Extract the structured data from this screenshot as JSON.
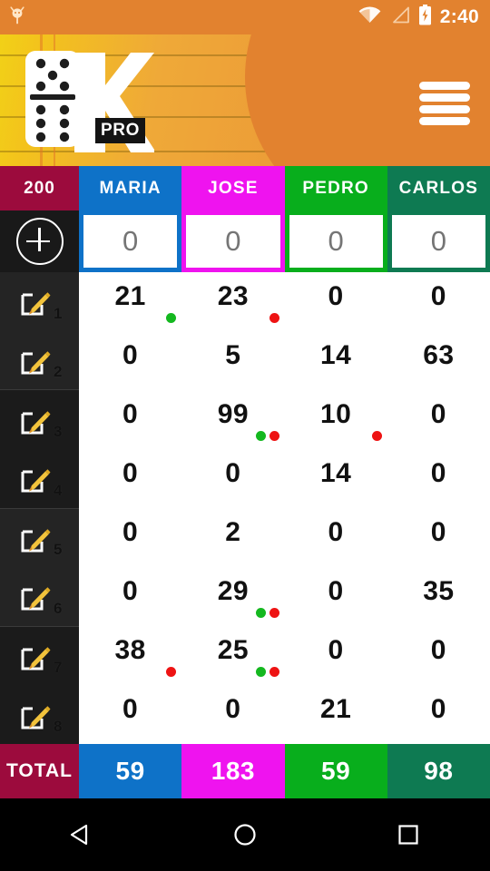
{
  "status_bar": {
    "notification_icon": "android-robot-icon",
    "wifi_icon": "wifi-icon",
    "signal_icon": "signal-triangle-icon",
    "battery_icon": "battery-charging-icon",
    "time": "2:40"
  },
  "header": {
    "logo_name": "domino-k-pro-logo",
    "logo_badge": "PRO",
    "menu_icon": "hamburger-menu-icon"
  },
  "colors": {
    "goal": "#9c0b3d",
    "maria": "#0e72c8",
    "jose": "#ef13ef",
    "pedro": "#08ae1c",
    "carlos": "#0e7a52",
    "accent_orange": "#e2822f",
    "dot_green": "#14b81f",
    "dot_red": "#ee1313"
  },
  "goal": {
    "label": "200"
  },
  "add_round_button": {
    "icon": "plus-circle-icon"
  },
  "players": [
    {
      "name": "MARIA",
      "color": "#0e72c8",
      "input_value": "",
      "input_placeholder": "0"
    },
    {
      "name": "JOSE",
      "color": "#ef13ef",
      "input_value": "",
      "input_placeholder": "0"
    },
    {
      "name": "PEDRO",
      "color": "#08ae1c",
      "input_value": "",
      "input_placeholder": "0"
    },
    {
      "name": "CARLOS",
      "color": "#0e7a52",
      "input_value": "",
      "input_placeholder": "0"
    }
  ],
  "rounds": [
    {
      "num": "1",
      "edit_icon": "pencil-edit-icon",
      "scores": [
        "21",
        "23",
        "0",
        "0"
      ],
      "marks": [
        [
          "green"
        ],
        [
          "red"
        ],
        [],
        []
      ]
    },
    {
      "num": "2",
      "edit_icon": "pencil-edit-icon",
      "scores": [
        "0",
        "5",
        "14",
        "63"
      ],
      "marks": [
        [],
        [],
        [],
        []
      ]
    },
    {
      "num": "3",
      "edit_icon": "pencil-edit-icon",
      "scores": [
        "0",
        "99",
        "10",
        "0"
      ],
      "marks": [
        [],
        [
          "green",
          "red"
        ],
        [
          "red"
        ],
        []
      ]
    },
    {
      "num": "4",
      "edit_icon": "pencil-edit-icon",
      "scores": [
        "0",
        "0",
        "14",
        "0"
      ],
      "marks": [
        [],
        [],
        [],
        []
      ]
    },
    {
      "num": "5",
      "edit_icon": "pencil-edit-icon",
      "scores": [
        "0",
        "2",
        "0",
        "0"
      ],
      "marks": [
        [],
        [],
        [],
        []
      ]
    },
    {
      "num": "6",
      "edit_icon": "pencil-edit-icon",
      "scores": [
        "0",
        "29",
        "0",
        "35"
      ],
      "marks": [
        [],
        [
          "green",
          "red"
        ],
        [],
        []
      ]
    },
    {
      "num": "7",
      "edit_icon": "pencil-edit-icon",
      "scores": [
        "38",
        "25",
        "0",
        "0"
      ],
      "marks": [
        [
          "red"
        ],
        [
          "green",
          "red"
        ],
        [],
        []
      ]
    },
    {
      "num": "8",
      "edit_icon": "pencil-edit-icon",
      "scores": [
        "0",
        "0",
        "21",
        "0"
      ],
      "marks": [
        [],
        [],
        [],
        []
      ]
    }
  ],
  "total": {
    "label": "TOTAL",
    "values": [
      "59",
      "183",
      "59",
      "98"
    ]
  },
  "navbar": {
    "back_icon": "nav-back-triangle-icon",
    "home_icon": "nav-home-circle-icon",
    "recents_icon": "nav-recents-square-icon"
  }
}
